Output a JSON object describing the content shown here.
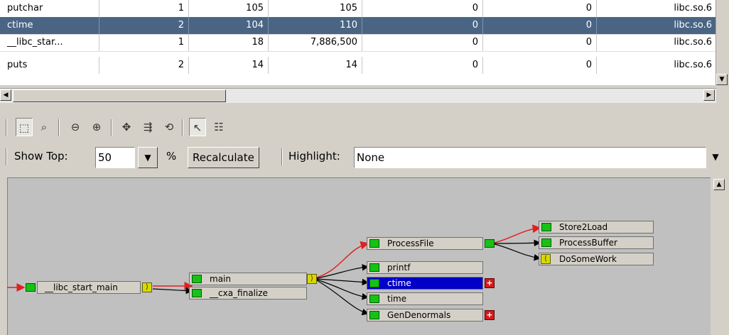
{
  "table": {
    "rows": [
      {
        "name": "putchar",
        "calls": "1",
        "self": "105",
        "total": "105",
        "c4": "0",
        "c5": "0",
        "module": "libc.so.6",
        "selected": false
      },
      {
        "name": "ctime",
        "calls": "2",
        "self": "104",
        "total": "110",
        "c4": "0",
        "c5": "0",
        "module": "libc.so.6",
        "selected": true
      },
      {
        "name": "__libc_star...",
        "calls": "1",
        "self": "18",
        "total": "7,886,500",
        "c4": "0",
        "c5": "0",
        "module": "libc.so.6",
        "selected": false
      },
      {
        "name": "puts",
        "calls": "2",
        "self": "14",
        "total": "14",
        "c4": "0",
        "c5": "0",
        "module": "libc.so.6",
        "selected": false
      }
    ]
  },
  "toolbar": {
    "icons": [
      "marquee-select-icon",
      "find-icon",
      "zoom-out-icon",
      "zoom-in-icon",
      "pan-icon",
      "expand-icon",
      "collapse-icon",
      "select-pointer-icon",
      "properties-icon"
    ]
  },
  "options": {
    "show_top_label": "Show Top:",
    "show_top_value": "50",
    "percent_label": "%",
    "recalculate_label": "Recalculate",
    "highlight_label": "Highlight:",
    "highlight_value": "None"
  },
  "graph": {
    "nodes": {
      "libc_start_main": "__libc_start_main",
      "main": "main",
      "cxa_finalize": "__cxa_finalize",
      "processfile": "ProcessFile",
      "printf": "printf",
      "ctime": "ctime",
      "time": "time",
      "gendenormals": "GenDenormals",
      "store2load": "Store2Load",
      "processbuffer": "ProcessBuffer",
      "dosomework": "DoSomeWork"
    },
    "colors": {
      "hot_edge": "#e02020",
      "edge": "#000000",
      "highlight_node": "#0000c8"
    }
  }
}
